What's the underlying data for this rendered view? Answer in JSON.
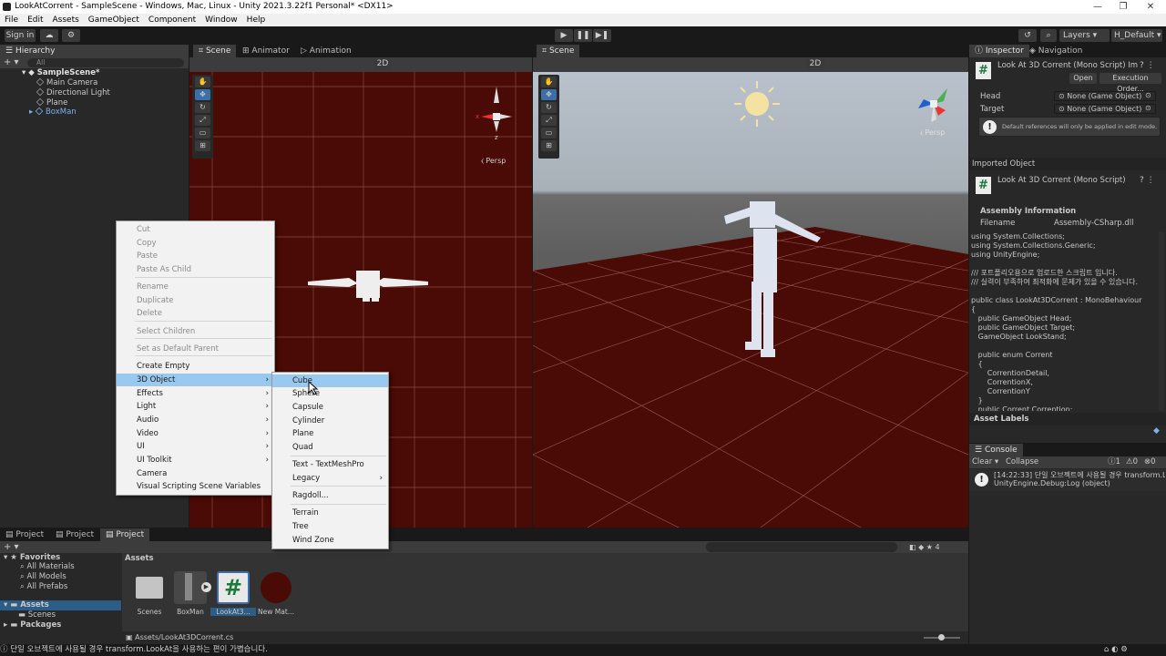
{
  "window": {
    "title": "LookAtCorrent - SampleScene - Windows, Mac, Linux - Unity 2021.3.22f1 Personal* <DX11>",
    "controls": [
      "—",
      "❐",
      "✕"
    ]
  },
  "menubar": [
    "File",
    "Edit",
    "Assets",
    "GameObject",
    "Component",
    "Window",
    "Help"
  ],
  "toolbar": {
    "sign_in": "Sign in",
    "layers": "Layers",
    "layout": "H_Default"
  },
  "hierarchy": {
    "tab": "Hierarchy",
    "search_placeholder": "All",
    "scene": "SampleScene*",
    "items": [
      "Main Camera",
      "Directional Light",
      "Plane",
      "BoxMan"
    ]
  },
  "scene_tabs": [
    "Scene",
    "Animator",
    "Animation"
  ],
  "scene_left": {
    "mode_2d": "2D",
    "persp": "Persp",
    "axis_x": "x",
    "axis_z": "z"
  },
  "scene_right": {
    "tab": "Scene",
    "mode_2d": "2D",
    "persp": "Persp"
  },
  "context_menu": {
    "items": [
      {
        "label": "Cut",
        "disabled": true
      },
      {
        "label": "Copy",
        "disabled": true
      },
      {
        "label": "Paste",
        "disabled": true
      },
      {
        "label": "Paste As Child",
        "disabled": true
      },
      {
        "label": "Rename",
        "disabled": true
      },
      {
        "label": "Duplicate",
        "disabled": true
      },
      {
        "label": "Delete",
        "disabled": true
      },
      {
        "label": "Select Children",
        "disabled": true
      },
      {
        "label": "Set as Default Parent",
        "disabled": true
      },
      {
        "label": "Create Empty",
        "disabled": false
      },
      {
        "label": "3D Object",
        "disabled": false,
        "submenu": true,
        "highlighted": true
      },
      {
        "label": "Effects",
        "disabled": false,
        "submenu": true
      },
      {
        "label": "Light",
        "disabled": false,
        "submenu": true
      },
      {
        "label": "Audio",
        "disabled": false,
        "submenu": true
      },
      {
        "label": "Video",
        "disabled": false,
        "submenu": true
      },
      {
        "label": "UI",
        "disabled": false,
        "submenu": true
      },
      {
        "label": "UI Toolkit",
        "disabled": false,
        "submenu": true
      },
      {
        "label": "Camera",
        "disabled": false
      },
      {
        "label": "Visual Scripting Scene Variables",
        "disabled": false
      }
    ],
    "submenu_items": [
      {
        "label": "Cube",
        "highlighted": true
      },
      {
        "label": "Sphere"
      },
      {
        "label": "Capsule"
      },
      {
        "label": "Cylinder"
      },
      {
        "label": "Plane"
      },
      {
        "label": "Quad"
      },
      {
        "label": "Text - TextMeshPro"
      },
      {
        "label": "Legacy",
        "submenu": true
      },
      {
        "label": "Ragdoll..."
      },
      {
        "label": "Terrain"
      },
      {
        "label": "Tree"
      },
      {
        "label": "Wind Zone"
      }
    ]
  },
  "inspector": {
    "tabs": [
      "Inspector",
      "Navigation"
    ],
    "script_title": "Look At 3D Corrent (Mono Script) Im",
    "open_button": "Open",
    "exec_order_button": "Execution Order...",
    "head_label": "Head",
    "head_value": "None (Game Object)",
    "target_label": "Target",
    "target_value": "None (Game Object)",
    "info": "Default references will only be applied in edit mode.",
    "imported_object": "Imported Object",
    "imported_title": "Look At 3D Corrent (Mono Script)",
    "assembly_info": "Assembly Information",
    "filename_label": "Filename",
    "filename_value": "Assembly-CSharp.dll",
    "code": "using System.Collections;\nusing System.Collections.Generic;\nusing UnityEngine;\n\n/// 포트폴리오용으로 업로드한 스크립트 입니다.\n/// 실력이 부족하여 최적화에 문제가 있을 수 있습니다.\n\npublic class LookAt3DCorrent : MonoBehaviour\n{\n   public GameObject Head;\n   public GameObject Target;\n   GameObject LookStand;\n\n   public enum Corrent\n   {\n       CorrentionDetail,\n       CorrentionX,\n       CorrentionY\n   }\n   public Corrent Corrention;",
    "asset_labels": "Asset Labels"
  },
  "console": {
    "tab": "Console",
    "clear": "Clear",
    "collapse": "Collapse",
    "count_log": "1",
    "count_warn": "0",
    "count_err": "0",
    "line1": "[14:22:33] 단일 오브젝트에 사용될 경우 transform.Lo",
    "line2": "UnityEngine.Debug:Log (object)"
  },
  "project": {
    "tabs": [
      "Project",
      "Project",
      "Project"
    ],
    "favorites": "Favorites",
    "fav_items": [
      "All Materials",
      "All Models",
      "All Prefabs"
    ],
    "assets": "Assets",
    "asset_folders": [
      "Scenes"
    ],
    "packages": "Packages",
    "breadcrumb": "Assets",
    "hidden_count": "4",
    "asset_items": [
      "Scenes",
      "BoxMan",
      "LookAt3...",
      "New Mat..."
    ],
    "path": "Assets/LookAt3DCorrent.cs"
  },
  "status": {
    "message": "단일 오브젝트에 사용될 경우 transform.LookAt을 사용하는 편이 가볍습니다."
  },
  "colors": {
    "accent": "#3d6ea8",
    "ground": "#4a0a05",
    "menu_highlight": "#99c9ef"
  }
}
